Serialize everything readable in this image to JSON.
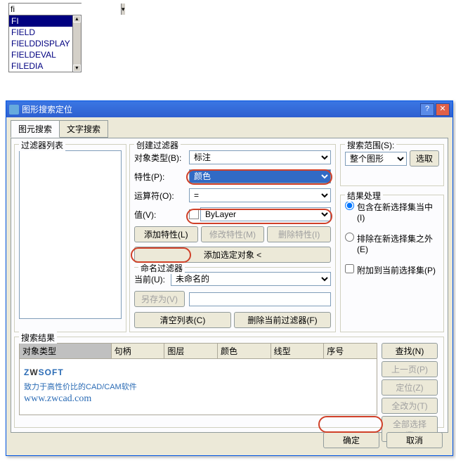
{
  "autocomplete": {
    "input_value": "fi",
    "items": [
      "FI",
      "FIELD",
      "FIELDDISPLAY",
      "FIELDEVAL",
      "FILEDIA"
    ],
    "selected_index": 0
  },
  "dialog": {
    "title": "图形搜索定位",
    "tabs": {
      "t1": "图元搜索",
      "t2": "文字搜索"
    },
    "filterlist": {
      "legend": "过滤器列表"
    },
    "create": {
      "legend": "创建过滤器",
      "obj_type_label": "对象类型(B):",
      "obj_type_value": "标注",
      "prop_label": "特性(P):",
      "prop_value": "颜色",
      "op_label": "运算符(O):",
      "op_value": "=",
      "val_label": "值(V):",
      "val_value": "ByLayer",
      "add_prop_btn": "添加特性(L)",
      "mod_prop_btn": "修改特性(M)",
      "del_prop_btn": "删除特性(I)",
      "add_sel_btn": "添加选定对象 <",
      "naming_legend": "命名过滤器",
      "cur_label": "当前(U):",
      "cur_value": "未命名的",
      "saveas_btn": "另存为(V)",
      "clear_btn": "清空列表(C)",
      "del_cur_btn": "删除当前过滤器(F)"
    },
    "scope": {
      "legend": "搜索范围(S):",
      "value": "整个图形",
      "pick_btn": "选取"
    },
    "result": {
      "legend": "结果处理",
      "opt1": "包含在新选择集当中(I)",
      "opt2": "排除在新选择集之外(E)",
      "opt3": "附加到当前选择集(P)"
    },
    "search": {
      "legend": "搜索结果",
      "cols": {
        "c1": "对象类型",
        "c2": "句柄",
        "c3": "图层",
        "c4": "颜色",
        "c5": "线型",
        "c6": "序号"
      },
      "btns": {
        "find": "查找(N)",
        "prev": "上一页(P)",
        "locate": "定位(Z)",
        "chall": "全改为(T)",
        "selall": "全部选择(F)"
      }
    },
    "footer": {
      "ok": "确定",
      "cancel": "取消"
    },
    "logo": {
      "brand_z": "Z",
      "brand_w": "W",
      "brand_soft": "SOFT",
      "tagline": "致力于高性价比的CAD/CAM软件",
      "url": "www.zwcad.com"
    }
  }
}
